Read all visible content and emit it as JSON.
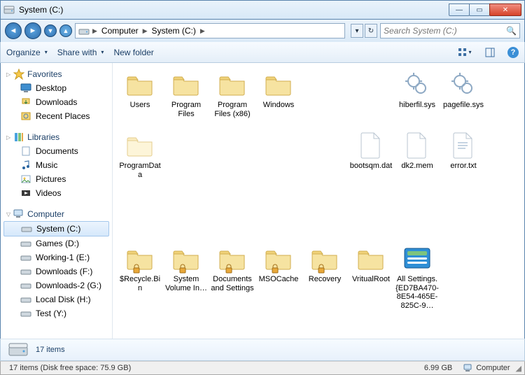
{
  "window": {
    "title": "System (C:)"
  },
  "address": {
    "segments": [
      "Computer",
      "System (C:)"
    ],
    "search_placeholder": "Search System (C:)"
  },
  "toolbar": {
    "organize": "Organize",
    "share": "Share with",
    "newfolder": "New folder"
  },
  "tree": {
    "favorites": {
      "label": "Favorites",
      "items": [
        "Desktop",
        "Downloads",
        "Recent Places"
      ]
    },
    "libraries": {
      "label": "Libraries",
      "items": [
        "Documents",
        "Music",
        "Pictures",
        "Videos"
      ]
    },
    "computer": {
      "label": "Computer",
      "items": [
        "System (C:)",
        "Games (D:)",
        "Working-1 (E:)",
        "Downloads (F:)",
        "Downloads-2 (G:)",
        "Local Disk (H:)",
        "Test (Y:)"
      ]
    }
  },
  "files": [
    {
      "name": "Users",
      "type": "folder"
    },
    {
      "name": "Program Files",
      "type": "folder"
    },
    {
      "name": "Program Files (x86)",
      "type": "folder"
    },
    {
      "name": "Windows",
      "type": "folder"
    },
    {
      "name": "",
      "type": "spacer"
    },
    {
      "name": "",
      "type": "spacer"
    },
    {
      "name": "hiberfil.sys",
      "type": "sys"
    },
    {
      "name": "pagefile.sys",
      "type": "sys"
    },
    {
      "name": "ProgramData",
      "type": "folder-light"
    },
    {
      "name": "",
      "type": "spacer"
    },
    {
      "name": "",
      "type": "spacer"
    },
    {
      "name": "",
      "type": "spacer"
    },
    {
      "name": "",
      "type": "spacer"
    },
    {
      "name": "bootsqm.dat",
      "type": "file"
    },
    {
      "name": "dk2.mem",
      "type": "file"
    },
    {
      "name": "error.txt",
      "type": "txt"
    },
    {
      "name": "",
      "type": "spacer"
    },
    {
      "name": "",
      "type": "spacer"
    },
    {
      "name": "",
      "type": "spacer"
    },
    {
      "name": "",
      "type": "spacer"
    },
    {
      "name": "",
      "type": "spacer"
    },
    {
      "name": "",
      "type": "spacer"
    },
    {
      "name": "",
      "type": "spacer"
    },
    {
      "name": "",
      "type": "spacer"
    },
    {
      "name": "$Recycle.Bin",
      "type": "folder-lock"
    },
    {
      "name": "System Volume In…",
      "type": "folder-lock"
    },
    {
      "name": "Documents and Settings",
      "type": "folder-lock"
    },
    {
      "name": "MSOCache",
      "type": "folder-lock"
    },
    {
      "name": "Recovery",
      "type": "folder-lock"
    },
    {
      "name": "VritualRoot",
      "type": "folder"
    },
    {
      "name": "All Settings.{ED7BA470-8E54-465E-825C-9…",
      "type": "cpl"
    }
  ],
  "details": {
    "count": "17 items"
  },
  "status": {
    "left": "17 items (Disk free space: 75.9 GB)",
    "size": "6.99 GB",
    "computer": "Computer"
  }
}
